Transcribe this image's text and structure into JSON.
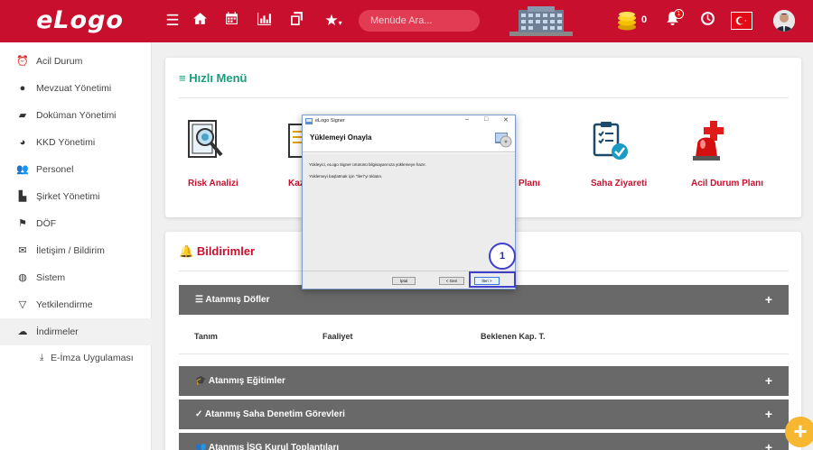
{
  "brand": {
    "logo_text": "eLogo",
    "accent_color": "#c8102e",
    "green_color": "#1a9c7e"
  },
  "topbar": {
    "icons": [
      "menu-icon",
      "home-icon",
      "calendar-icon",
      "chart-icon",
      "copy-icon",
      "star-icon"
    ],
    "search_placeholder": "Menüde Ara...",
    "coin_count": "0",
    "notification_count": "1"
  },
  "sidebar": {
    "items": [
      {
        "label": "Acil Durum",
        "icon": "alarm-icon"
      },
      {
        "label": "Mevzuat Yönetimi",
        "icon": "info-icon"
      },
      {
        "label": "Doküman Yönetimi",
        "icon": "folder-icon"
      },
      {
        "label": "KKD Yönetimi",
        "icon": "helmet-icon"
      },
      {
        "label": "Personel",
        "icon": "users-icon"
      },
      {
        "label": "Şirket Yönetimi",
        "icon": "building-icon"
      },
      {
        "label": "DÖF",
        "icon": "flag-icon"
      },
      {
        "label": "İletişim / Bildirim",
        "icon": "mail-icon"
      },
      {
        "label": "Sistem",
        "icon": "globe-icon"
      },
      {
        "label": "Yetkilendirme",
        "icon": "filter-icon"
      },
      {
        "label": "İndirmeler",
        "icon": "cloud-download-icon"
      }
    ],
    "sub_item": {
      "label": "E-İmza Uygulaması",
      "icon": "download-icon"
    }
  },
  "quick_menu": {
    "title": "Hızlı Menü",
    "items": [
      {
        "label": "Risk Analizi",
        "icon": "risk-analysis-icon"
      },
      {
        "label": "Kaz",
        "icon": "accident-icon"
      },
      {
        "label": "Planı",
        "icon": "plan-icon"
      },
      {
        "label": "Saha Ziyareti",
        "icon": "site-visit-icon"
      },
      {
        "label": "Acil Durum Planı",
        "icon": "emergency-icon"
      }
    ]
  },
  "notifications": {
    "title": "Bildirimler",
    "sections": [
      {
        "label": "Atanmış Döfler",
        "icon": "list-icon"
      },
      {
        "label": "Atanmış Eğitimler",
        "icon": "graduation-cap-icon"
      },
      {
        "label": "Atanmış Saha Denetim Görevleri",
        "icon": "check-icon"
      },
      {
        "label": "Atanmış İSG Kurul Toplantıları",
        "icon": "group-icon"
      }
    ],
    "table_headers": [
      "Tanım",
      "Faaliyet",
      "Beklenen Kap. T."
    ]
  },
  "dialog": {
    "window_title": "eLogo Signer",
    "heading": "Yüklemeyi Onayla",
    "line1": "Yükleyici, eLogo Signer ürününü bilgisayarınıza yüklemeye hazır.",
    "line2": "Yüklemeyi başlatmak için \"İleri\"yi tıklatın.",
    "cancel": "İptal",
    "back": "< Geri",
    "next": "İleri >",
    "ctrl_min": "–",
    "ctrl_max": "□",
    "ctrl_close": "✕"
  },
  "annotation": {
    "step": "1"
  }
}
